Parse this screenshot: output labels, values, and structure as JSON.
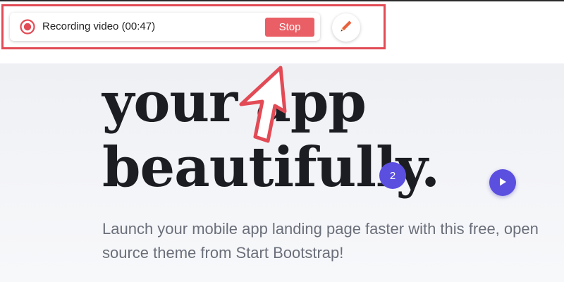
{
  "recording_bar": {
    "status_text": "Recording video (00:47)",
    "stop_label": "Stop"
  },
  "hero": {
    "title_line1": "your app",
    "title_line2": "beautifully.",
    "subtitle": "Launch your mobile app landing page faster with this free, open source theme from Start Bootstrap!"
  },
  "overlay": {
    "step_badge": "2"
  },
  "icons": {
    "record": "record-icon",
    "pencil": "pencil-icon",
    "cursor": "cursor-arrow-icon",
    "play": "play-icon"
  },
  "colors": {
    "highlight": "#e24b55",
    "stop_button": "#e95f65",
    "accent": "#5b4fe0",
    "headline": "#1c1d22",
    "body_text": "#6b6f7a"
  }
}
